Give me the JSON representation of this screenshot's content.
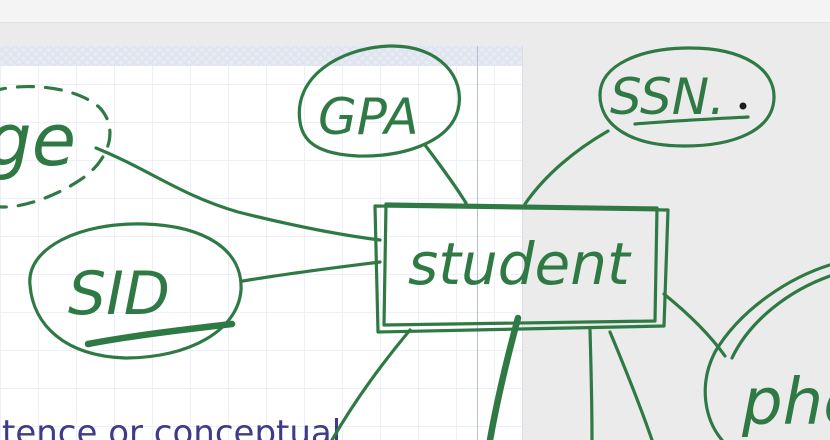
{
  "whiteboard": {
    "attributes": {
      "gpa": "GPA",
      "ssn": "SSN.",
      "sid": "SID",
      "age_partial": "ge",
      "phone_partial": "pho"
    },
    "entity": {
      "student": "student"
    },
    "ink_color": "#2f7a44"
  },
  "slide": {
    "partial_text": "tence or conceptual"
  }
}
